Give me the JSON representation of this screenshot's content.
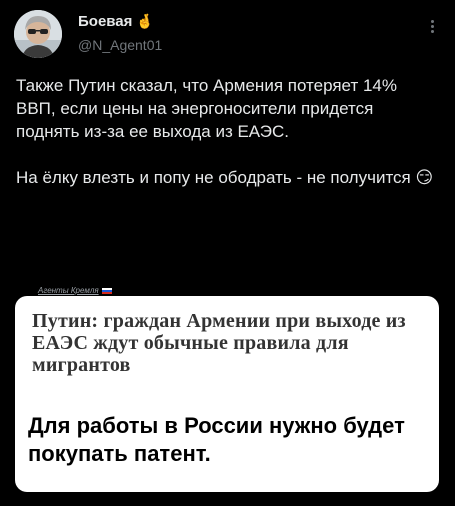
{
  "author": {
    "display_name": "Боевая",
    "name_emoji": "🤞",
    "handle": "@N_Agent01",
    "avatar_icon": "user-avatar-photo"
  },
  "tweet": {
    "text": "Также Путин сказал, что Армения потеряет 14% ВВП, если цены на энергоносители придется поднять из-за ее выхода из ЕАЭС.\n\nНа ёлку влезть и попу не ободрать - не получится 😏"
  },
  "media": {
    "source_tag": "Агенты Кремля",
    "headline": "Путин: граждан Армении при выходе из ЕАЭС ждут обычные правила для мигрантов",
    "body": "Для работы в России нужно будет покупать патент."
  },
  "colors": {
    "background": "#000000",
    "text_primary": "#e7e9ea",
    "text_secondary": "#71767b",
    "card_bg": "#ffffff"
  }
}
